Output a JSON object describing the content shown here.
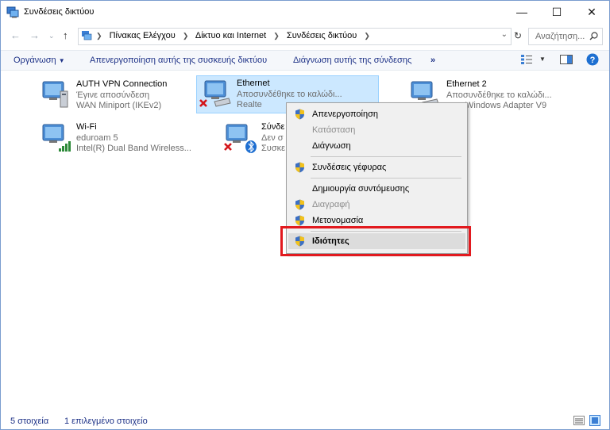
{
  "window": {
    "title": "Συνδέσεις δικτύου",
    "minimize_glyph": "—",
    "maximize_glyph": "☐",
    "close_glyph": "✕"
  },
  "address": {
    "crumbs": [
      "Πίνακας Ελέγχου",
      "Δίκτυο και Internet",
      "Συνδέσεις δικτύου"
    ],
    "search_placeholder": "Αναζήτηση..."
  },
  "commands": {
    "organize": "Οργάνωση",
    "disable": "Απενεργοποίηση αυτής της συσκευής δικτύου",
    "diagnose": "Διάγνωση αυτής της σύνδεσης",
    "more": "»"
  },
  "connections": [
    {
      "name": "AUTH VPN Connection",
      "status": "Έγινε αποσύνδεση",
      "device": "WAN Miniport (IKEv2)"
    },
    {
      "name": "Ethernet",
      "status": "Αποσυνδέθηκε το καλώδι...",
      "device": "Realte"
    },
    {
      "name": "Ethernet 2",
      "status": "Αποσυνδέθηκε το καλώδι...",
      "device": "Windows Adapter V9"
    },
    {
      "name": "Wi-Fi",
      "status": "eduroam  5",
      "device": "Intel(R) Dual Band Wireless..."
    },
    {
      "name": "Σύνδε",
      "status": "Δεν σ",
      "device": "Συσκε"
    }
  ],
  "context_menu": {
    "items": [
      {
        "label": "Απενεργοποίηση",
        "enabled": true,
        "shield": true
      },
      {
        "label": "Κατάσταση",
        "enabled": false,
        "shield": false
      },
      {
        "label": "Διάγνωση",
        "enabled": true,
        "shield": false
      },
      {
        "label": "Συνδέσεις γέφυρας",
        "enabled": true,
        "shield": true
      },
      {
        "label": "Δημιουργία συντόμευσης",
        "enabled": true,
        "shield": false
      },
      {
        "label": "Διαγραφή",
        "enabled": false,
        "shield": true
      },
      {
        "label": "Μετονομασία",
        "enabled": true,
        "shield": true
      },
      {
        "label": "Ιδιότητες",
        "enabled": true,
        "shield": true,
        "highlighted": true
      }
    ]
  },
  "statusbar": {
    "count": "5 στοιχεία",
    "selected": "1 επιλεγμένο στοιχείο"
  },
  "colors": {
    "accent_link": "#1e3287",
    "selection_bg": "#cce8ff",
    "highlight_box": "#e2191e",
    "help_blue": "#1d6fd1"
  }
}
